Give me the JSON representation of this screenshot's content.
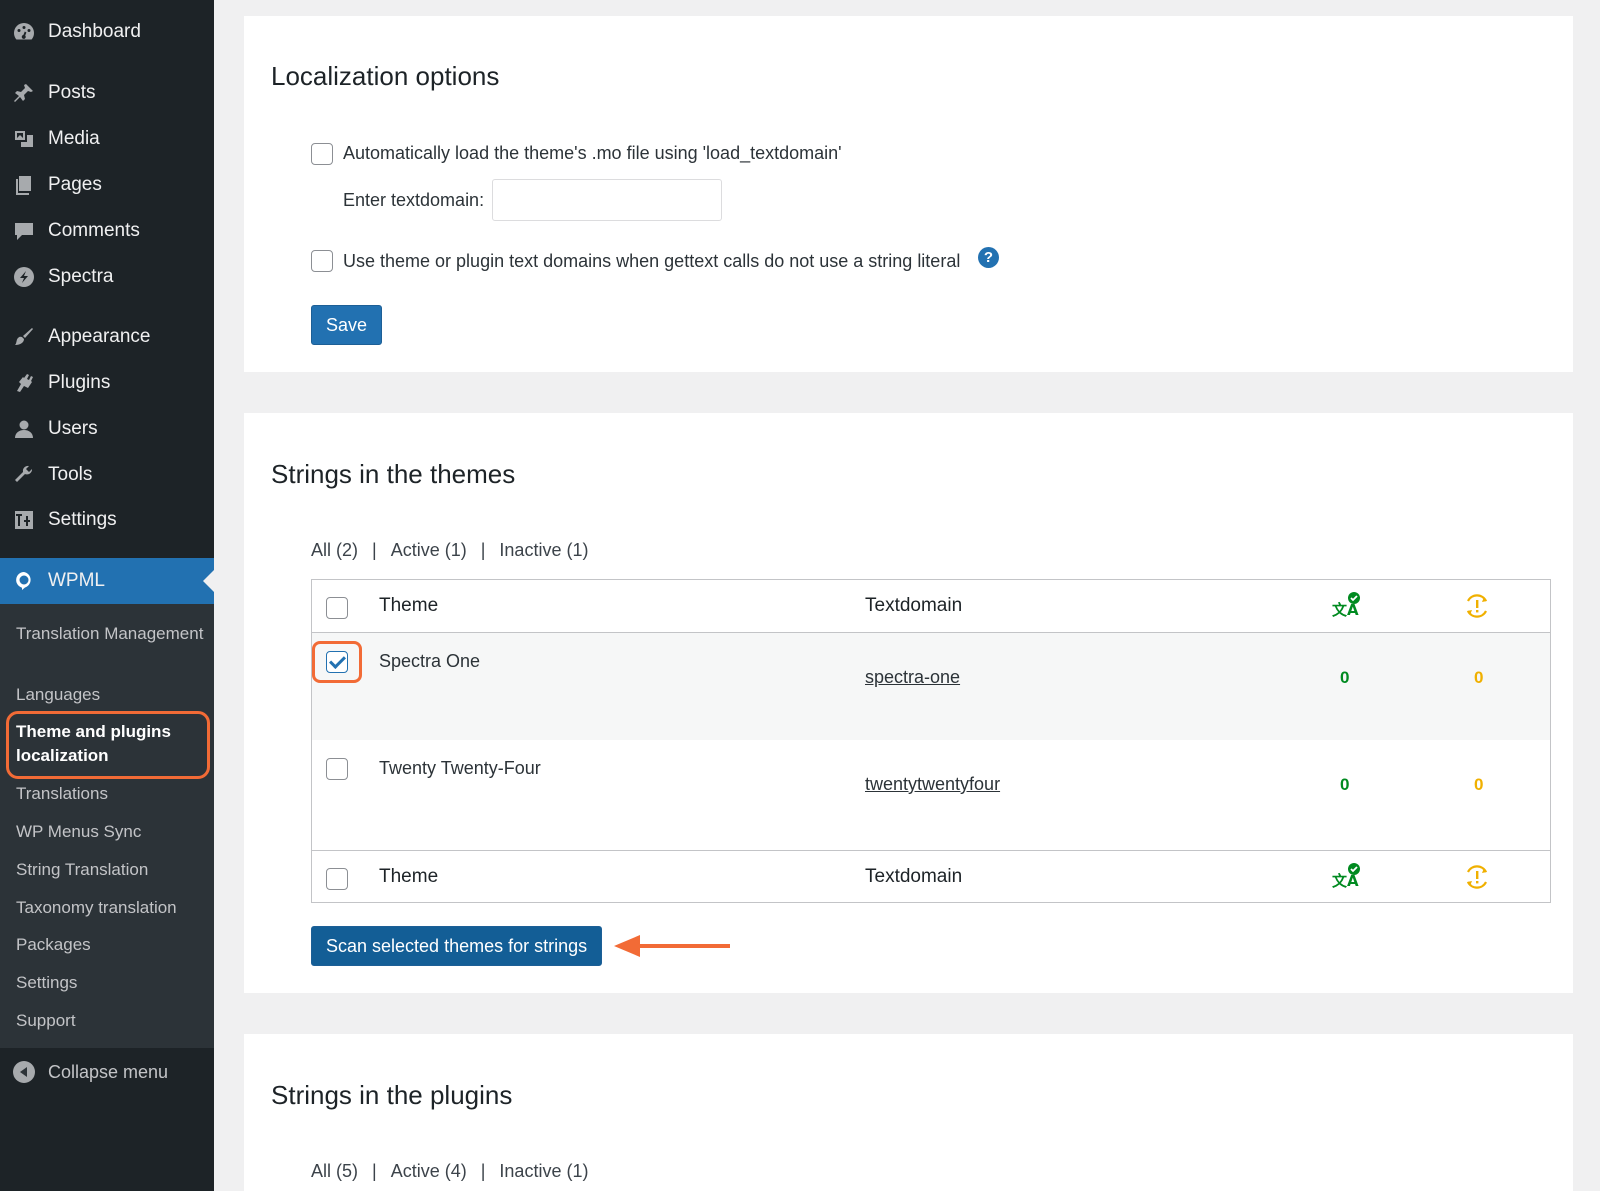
{
  "sidebar": {
    "items": [
      {
        "label": "Dashboard",
        "icon": "dashboard-icon"
      },
      {
        "label": "Posts",
        "icon": "pin-icon"
      },
      {
        "label": "Media",
        "icon": "media-icon"
      },
      {
        "label": "Pages",
        "icon": "pages-icon"
      },
      {
        "label": "Comments",
        "icon": "comment-icon"
      },
      {
        "label": "Spectra",
        "icon": "spectra-icon"
      },
      {
        "label": "Appearance",
        "icon": "brush-icon"
      },
      {
        "label": "Plugins",
        "icon": "plug-icon"
      },
      {
        "label": "Users",
        "icon": "user-icon"
      },
      {
        "label": "Tools",
        "icon": "wrench-icon"
      },
      {
        "label": "Settings",
        "icon": "settings-icon"
      },
      {
        "label": "WPML",
        "icon": "wpml-icon"
      }
    ],
    "submenu": [
      "Translation Management",
      "Languages",
      "Theme and plugins localization",
      "Translations",
      "WP Menus Sync",
      "String Translation",
      "Taxonomy translation",
      "Packages",
      "Settings",
      "Support"
    ],
    "collapse_label": "Collapse menu"
  },
  "localization": {
    "title": "Localization options",
    "opt1_label": "Automatically load the theme's .mo file using 'load_textdomain'",
    "textdomain_label": "Enter textdomain:",
    "textdomain_value": "",
    "opt2_label": "Use theme or plugin text domains when gettext calls do not use a string literal",
    "help": "?",
    "save_label": "Save"
  },
  "themes": {
    "title": "Strings in the themes",
    "filters": {
      "all": "All (2)",
      "active": "Active (1)",
      "inactive": "Inactive (1)",
      "sep": "|"
    },
    "header": {
      "theme": "Theme",
      "textdomain": "Textdomain"
    },
    "rows": [
      {
        "name": "Spectra One",
        "textdomain": "spectra-one",
        "translated": "0",
        "pending": "0",
        "checked": true
      },
      {
        "name": "Twenty Twenty-Four",
        "textdomain": "twentytwentyfour",
        "translated": "0",
        "pending": "0",
        "checked": false
      }
    ],
    "scan_label": "Scan selected themes for strings",
    "highlight_color": "#f26b36"
  },
  "plugins": {
    "title": "Strings in the plugins",
    "filters": {
      "all": "All (5)",
      "active": "Active (4)",
      "inactive": "Inactive (1)",
      "sep": "|"
    }
  }
}
